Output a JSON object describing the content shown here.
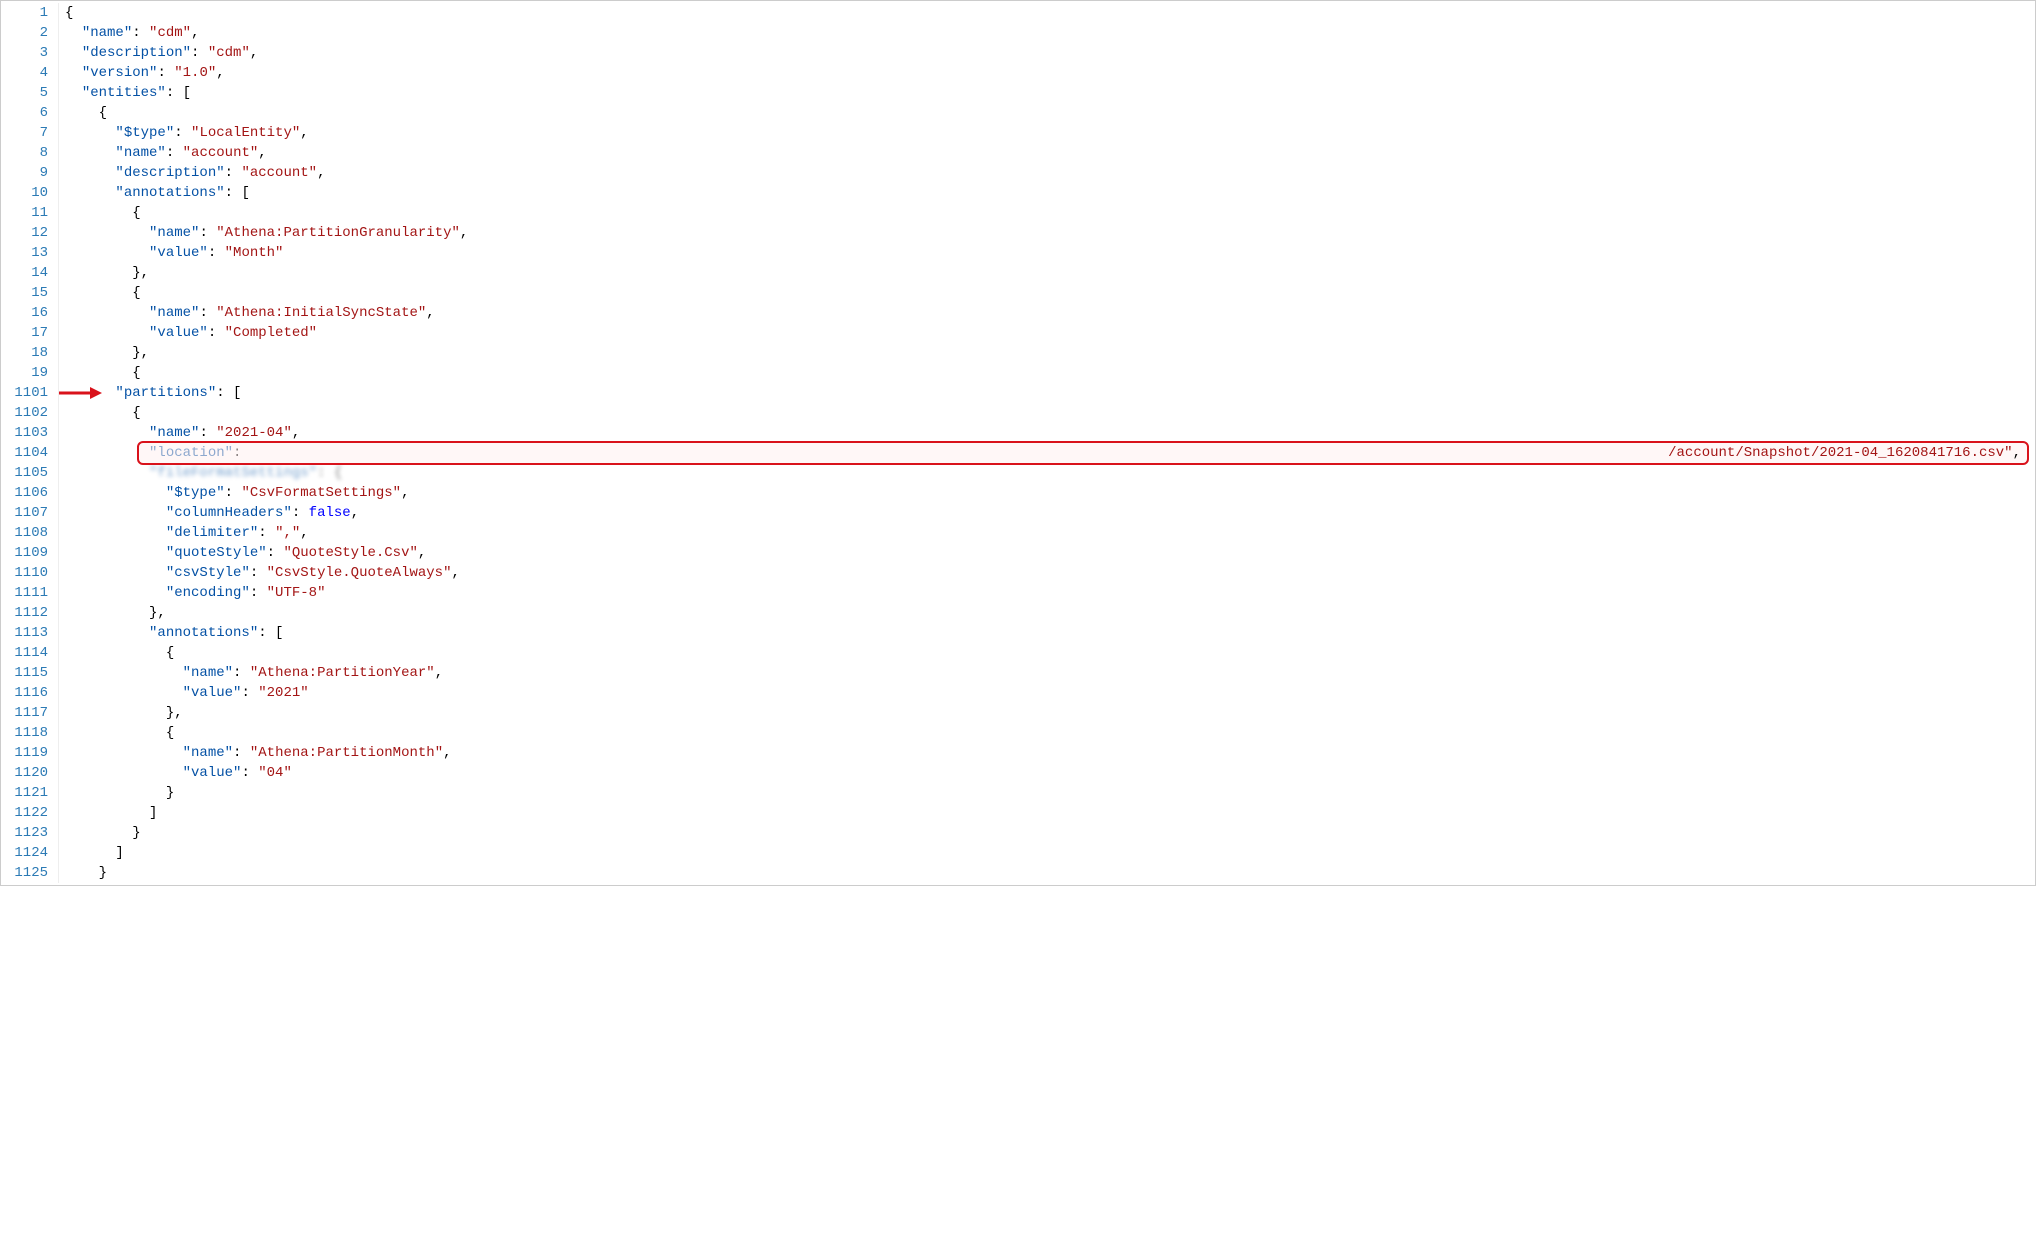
{
  "annotations": {
    "arrow_target_line": "1101",
    "boxed_visible_text": "/account/Snapshot/2021-04_1620841716.csv\""
  },
  "code_lines": [
    {
      "num": "1",
      "tokens": [
        {
          "t": "{",
          "c": "brace"
        }
      ]
    },
    {
      "num": "2",
      "tokens": [
        {
          "t": "  ",
          "c": "ws"
        },
        {
          "t": "\"name\"",
          "c": "key"
        },
        {
          "t": ": ",
          "c": "punc"
        },
        {
          "t": "\"cdm\"",
          "c": "str"
        },
        {
          "t": ",",
          "c": "punc"
        }
      ]
    },
    {
      "num": "3",
      "tokens": [
        {
          "t": "  ",
          "c": "ws"
        },
        {
          "t": "\"description\"",
          "c": "key"
        },
        {
          "t": ": ",
          "c": "punc"
        },
        {
          "t": "\"cdm\"",
          "c": "str"
        },
        {
          "t": ",",
          "c": "punc"
        }
      ]
    },
    {
      "num": "4",
      "tokens": [
        {
          "t": "  ",
          "c": "ws"
        },
        {
          "t": "\"version\"",
          "c": "key"
        },
        {
          "t": ": ",
          "c": "punc"
        },
        {
          "t": "\"1.0\"",
          "c": "str"
        },
        {
          "t": ",",
          "c": "punc"
        }
      ]
    },
    {
      "num": "5",
      "tokens": [
        {
          "t": "  ",
          "c": "ws"
        },
        {
          "t": "\"entities\"",
          "c": "key"
        },
        {
          "t": ": [",
          "c": "punc"
        }
      ]
    },
    {
      "num": "6",
      "tokens": [
        {
          "t": "    ",
          "c": "ws"
        },
        {
          "t": "{",
          "c": "brace"
        }
      ]
    },
    {
      "num": "7",
      "tokens": [
        {
          "t": "      ",
          "c": "ws"
        },
        {
          "t": "\"$type\"",
          "c": "key"
        },
        {
          "t": ": ",
          "c": "punc"
        },
        {
          "t": "\"LocalEntity\"",
          "c": "str"
        },
        {
          "t": ",",
          "c": "punc"
        }
      ]
    },
    {
      "num": "8",
      "tokens": [
        {
          "t": "      ",
          "c": "ws"
        },
        {
          "t": "\"name\"",
          "c": "key"
        },
        {
          "t": ": ",
          "c": "punc"
        },
        {
          "t": "\"account\"",
          "c": "str"
        },
        {
          "t": ",",
          "c": "punc"
        }
      ]
    },
    {
      "num": "9",
      "tokens": [
        {
          "t": "      ",
          "c": "ws"
        },
        {
          "t": "\"description\"",
          "c": "key"
        },
        {
          "t": ": ",
          "c": "punc"
        },
        {
          "t": "\"account\"",
          "c": "str"
        },
        {
          "t": ",",
          "c": "punc"
        }
      ]
    },
    {
      "num": "10",
      "tokens": [
        {
          "t": "      ",
          "c": "ws"
        },
        {
          "t": "\"annotations\"",
          "c": "key"
        },
        {
          "t": ": [",
          "c": "punc"
        }
      ]
    },
    {
      "num": "11",
      "tokens": [
        {
          "t": "        ",
          "c": "ws"
        },
        {
          "t": "{",
          "c": "brace"
        }
      ]
    },
    {
      "num": "12",
      "tokens": [
        {
          "t": "          ",
          "c": "ws"
        },
        {
          "t": "\"name\"",
          "c": "key"
        },
        {
          "t": ": ",
          "c": "punc"
        },
        {
          "t": "\"Athena:PartitionGranularity\"",
          "c": "str"
        },
        {
          "t": ",",
          "c": "punc"
        }
      ]
    },
    {
      "num": "13",
      "tokens": [
        {
          "t": "          ",
          "c": "ws"
        },
        {
          "t": "\"value\"",
          "c": "key"
        },
        {
          "t": ": ",
          "c": "punc"
        },
        {
          "t": "\"Month\"",
          "c": "str"
        }
      ]
    },
    {
      "num": "14",
      "tokens": [
        {
          "t": "        ",
          "c": "ws"
        },
        {
          "t": "},",
          "c": "punc"
        }
      ]
    },
    {
      "num": "15",
      "tokens": [
        {
          "t": "        ",
          "c": "ws"
        },
        {
          "t": "{",
          "c": "brace"
        }
      ]
    },
    {
      "num": "16",
      "tokens": [
        {
          "t": "          ",
          "c": "ws"
        },
        {
          "t": "\"name\"",
          "c": "key"
        },
        {
          "t": ": ",
          "c": "punc"
        },
        {
          "t": "\"Athena:InitialSyncState\"",
          "c": "str"
        },
        {
          "t": ",",
          "c": "punc"
        }
      ]
    },
    {
      "num": "17",
      "tokens": [
        {
          "t": "          ",
          "c": "ws"
        },
        {
          "t": "\"value\"",
          "c": "key"
        },
        {
          "t": ": ",
          "c": "punc"
        },
        {
          "t": "\"Completed\"",
          "c": "str"
        }
      ]
    },
    {
      "num": "18",
      "tokens": [
        {
          "t": "        ",
          "c": "ws"
        },
        {
          "t": "},",
          "c": "punc"
        }
      ]
    },
    {
      "num": "19",
      "tokens": [
        {
          "t": "        ",
          "c": "ws"
        },
        {
          "t": "{",
          "c": "brace"
        }
      ]
    },
    {
      "num": "1101",
      "tokens": [
        {
          "t": "      ",
          "c": "ws"
        },
        {
          "t": "\"partitions\"",
          "c": "key"
        },
        {
          "t": ": [",
          "c": "punc"
        }
      ]
    },
    {
      "num": "1102",
      "tokens": [
        {
          "t": "        ",
          "c": "ws"
        },
        {
          "t": "{",
          "c": "brace"
        }
      ]
    },
    {
      "num": "1103",
      "tokens": [
        {
          "t": "          ",
          "c": "ws"
        },
        {
          "t": "\"name\"",
          "c": "key"
        },
        {
          "t": ": ",
          "c": "punc"
        },
        {
          "t": "\"2021-04\"",
          "c": "str"
        },
        {
          "t": ",",
          "c": "punc"
        }
      ]
    },
    {
      "num": "1104",
      "tokens": [
        {
          "t": "          ",
          "c": "ws"
        },
        {
          "t": "\"location\"",
          "c": "key"
        },
        {
          "t": ":",
          "c": "punc"
        }
      ]
    },
    {
      "num": "1105",
      "tokens": [
        {
          "t": "          ",
          "c": "ws"
        },
        {
          "t": "\"fileFormatSettings\"",
          "c": "key"
        },
        {
          "t": ": {",
          "c": "punc"
        }
      ],
      "ghost": true
    },
    {
      "num": "1106",
      "tokens": [
        {
          "t": "            ",
          "c": "ws"
        },
        {
          "t": "\"$type\"",
          "c": "key"
        },
        {
          "t": ": ",
          "c": "punc"
        },
        {
          "t": "\"CsvFormatSettings\"",
          "c": "str"
        },
        {
          "t": ",",
          "c": "punc"
        }
      ]
    },
    {
      "num": "1107",
      "tokens": [
        {
          "t": "            ",
          "c": "ws"
        },
        {
          "t": "\"columnHeaders\"",
          "c": "key"
        },
        {
          "t": ": ",
          "c": "punc"
        },
        {
          "t": "false",
          "c": "bool"
        },
        {
          "t": ",",
          "c": "punc"
        }
      ]
    },
    {
      "num": "1108",
      "tokens": [
        {
          "t": "            ",
          "c": "ws"
        },
        {
          "t": "\"delimiter\"",
          "c": "key"
        },
        {
          "t": ": ",
          "c": "punc"
        },
        {
          "t": "\",\"",
          "c": "str"
        },
        {
          "t": ",",
          "c": "punc"
        }
      ]
    },
    {
      "num": "1109",
      "tokens": [
        {
          "t": "            ",
          "c": "ws"
        },
        {
          "t": "\"quoteStyle\"",
          "c": "key"
        },
        {
          "t": ": ",
          "c": "punc"
        },
        {
          "t": "\"QuoteStyle.Csv\"",
          "c": "str"
        },
        {
          "t": ",",
          "c": "punc"
        }
      ]
    },
    {
      "num": "1110",
      "tokens": [
        {
          "t": "            ",
          "c": "ws"
        },
        {
          "t": "\"csvStyle\"",
          "c": "key"
        },
        {
          "t": ": ",
          "c": "punc"
        },
        {
          "t": "\"CsvStyle.QuoteAlways\"",
          "c": "str"
        },
        {
          "t": ",",
          "c": "punc"
        }
      ]
    },
    {
      "num": "1111",
      "tokens": [
        {
          "t": "            ",
          "c": "ws"
        },
        {
          "t": "\"encoding\"",
          "c": "key"
        },
        {
          "t": ": ",
          "c": "punc"
        },
        {
          "t": "\"UTF-8\"",
          "c": "str"
        }
      ]
    },
    {
      "num": "1112",
      "tokens": [
        {
          "t": "          ",
          "c": "ws"
        },
        {
          "t": "},",
          "c": "punc"
        }
      ]
    },
    {
      "num": "1113",
      "tokens": [
        {
          "t": "          ",
          "c": "ws"
        },
        {
          "t": "\"annotations\"",
          "c": "key"
        },
        {
          "t": ": [",
          "c": "punc"
        }
      ]
    },
    {
      "num": "1114",
      "tokens": [
        {
          "t": "            ",
          "c": "ws"
        },
        {
          "t": "{",
          "c": "brace"
        }
      ]
    },
    {
      "num": "1115",
      "tokens": [
        {
          "t": "              ",
          "c": "ws"
        },
        {
          "t": "\"name\"",
          "c": "key"
        },
        {
          "t": ": ",
          "c": "punc"
        },
        {
          "t": "\"Athena:PartitionYear\"",
          "c": "str"
        },
        {
          "t": ",",
          "c": "punc"
        }
      ]
    },
    {
      "num": "1116",
      "tokens": [
        {
          "t": "              ",
          "c": "ws"
        },
        {
          "t": "\"value\"",
          "c": "key"
        },
        {
          "t": ": ",
          "c": "punc"
        },
        {
          "t": "\"2021\"",
          "c": "str"
        }
      ]
    },
    {
      "num": "1117",
      "tokens": [
        {
          "t": "            ",
          "c": "ws"
        },
        {
          "t": "},",
          "c": "punc"
        }
      ]
    },
    {
      "num": "1118",
      "tokens": [
        {
          "t": "            ",
          "c": "ws"
        },
        {
          "t": "{",
          "c": "brace"
        }
      ]
    },
    {
      "num": "1119",
      "tokens": [
        {
          "t": "              ",
          "c": "ws"
        },
        {
          "t": "\"name\"",
          "c": "key"
        },
        {
          "t": ": ",
          "c": "punc"
        },
        {
          "t": "\"Athena:PartitionMonth\"",
          "c": "str"
        },
        {
          "t": ",",
          "c": "punc"
        }
      ]
    },
    {
      "num": "1120",
      "tokens": [
        {
          "t": "              ",
          "c": "ws"
        },
        {
          "t": "\"value\"",
          "c": "key"
        },
        {
          "t": ": ",
          "c": "punc"
        },
        {
          "t": "\"04\"",
          "c": "str"
        }
      ]
    },
    {
      "num": "1121",
      "tokens": [
        {
          "t": "            ",
          "c": "ws"
        },
        {
          "t": "}",
          "c": "brace"
        }
      ]
    },
    {
      "num": "1122",
      "tokens": [
        {
          "t": "          ",
          "c": "ws"
        },
        {
          "t": "]",
          "c": "punc"
        }
      ]
    },
    {
      "num": "1123",
      "tokens": [
        {
          "t": "        ",
          "c": "ws"
        },
        {
          "t": "}",
          "c": "brace"
        }
      ]
    },
    {
      "num": "1124",
      "tokens": [
        {
          "t": "      ",
          "c": "ws"
        },
        {
          "t": "]",
          "c": "punc"
        }
      ]
    },
    {
      "num": "1125",
      "tokens": [
        {
          "t": "    ",
          "c": "ws"
        },
        {
          "t": "}",
          "c": "brace"
        }
      ]
    }
  ]
}
